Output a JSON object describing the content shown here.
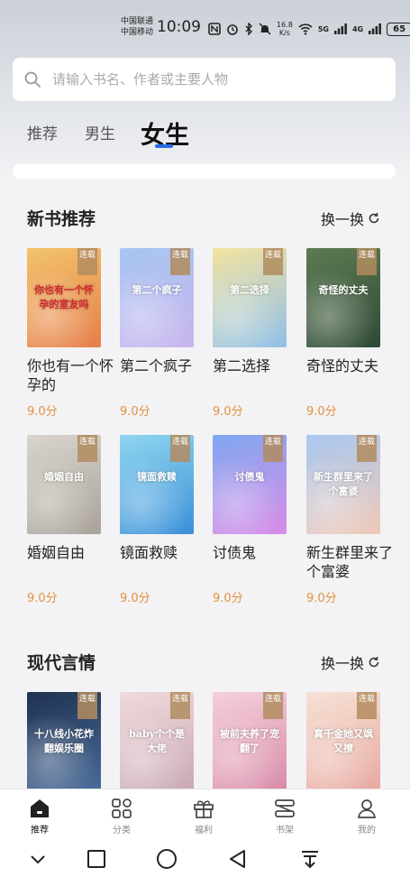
{
  "status": {
    "carrier_1": "中国联通",
    "carrier_2": "中国移动",
    "time": "10:09",
    "net_speed_value": "16.8",
    "net_speed_unit": "K/s",
    "signal_1": "5G",
    "signal_2": "4G",
    "battery": "65"
  },
  "search": {
    "placeholder": "请输入书名、作者或主要人物"
  },
  "tabs": [
    "推荐",
    "男生",
    "女生"
  ],
  "active_tab": "女生",
  "sections": [
    {
      "title": "新书推荐",
      "refresh_label": "换一换",
      "books": [
        {
          "title": "你也有一个怀孕的",
          "score": "9.0分",
          "badge": "连载",
          "cover_text": "你也有一个怀孕的室友吗",
          "colors": [
            "#f2c36b",
            "#e67e4a"
          ]
        },
        {
          "title": "第二个疯子",
          "score": "9.0分",
          "badge": "连载",
          "cover_text": "第二个疯子",
          "colors": [
            "#a7c6f2",
            "#c9b5ee"
          ]
        },
        {
          "title": "第二选择",
          "score": "9.0分",
          "badge": "连载",
          "cover_text": "第二选择",
          "colors": [
            "#f3e3a0",
            "#8fc0e8"
          ]
        },
        {
          "title": "奇怪的丈夫",
          "score": "9.0分",
          "badge": "连载",
          "cover_text": "奇怪的丈夫",
          "colors": [
            "#5d7a52",
            "#2f4a36"
          ]
        }
      ]
    },
    {
      "title": "",
      "books": [
        {
          "title": "婚姻自由",
          "score": "9.0分",
          "badge": "连载",
          "cover_text": "婚姻自由",
          "colors": [
            "#d9d4cc",
            "#a8a29a"
          ]
        },
        {
          "title": "镜面救赎",
          "score": "9.0分",
          "badge": "连载",
          "cover_text": "镜面救赎",
          "colors": [
            "#8fd6f0",
            "#3a8fd8"
          ]
        },
        {
          "title": "讨债鬼",
          "score": "9.0分",
          "badge": "连载",
          "cover_text": "讨债鬼",
          "colors": [
            "#7fa8f0",
            "#d88be8"
          ]
        },
        {
          "title": "新生群里来了个富婆",
          "score": "9.0分",
          "badge": "连载",
          "cover_text": "新生群里来了个富婆",
          "colors": [
            "#a9c8f0",
            "#f0c9b8"
          ]
        }
      ]
    },
    {
      "title": "现代言情",
      "refresh_label": "换一换",
      "books": [
        {
          "badge": "连载",
          "cover_text": "十八线小花炸翻娱乐圈",
          "colors": [
            "#1f3252",
            "#4a6b9a"
          ]
        },
        {
          "badge": "连载",
          "cover_text": "baby个个是大佬",
          "colors": [
            "#f0dadb",
            "#c8a8b4"
          ]
        },
        {
          "badge": "连载",
          "cover_text": "被前夫养了宠翻了",
          "colors": [
            "#f5d0dc",
            "#d88aa8"
          ]
        },
        {
          "badge": "连载",
          "cover_text": "真千金她又飒又撩",
          "colors": [
            "#f6e2d6",
            "#e8a8a0"
          ]
        }
      ]
    }
  ],
  "bottom_nav": [
    {
      "label": "推荐",
      "icon": "home-icon"
    },
    {
      "label": "分类",
      "icon": "category-icon"
    },
    {
      "label": "福利",
      "icon": "gift-icon"
    },
    {
      "label": "书架",
      "icon": "bookshelf-icon"
    },
    {
      "label": "我的",
      "icon": "profile-icon"
    }
  ]
}
